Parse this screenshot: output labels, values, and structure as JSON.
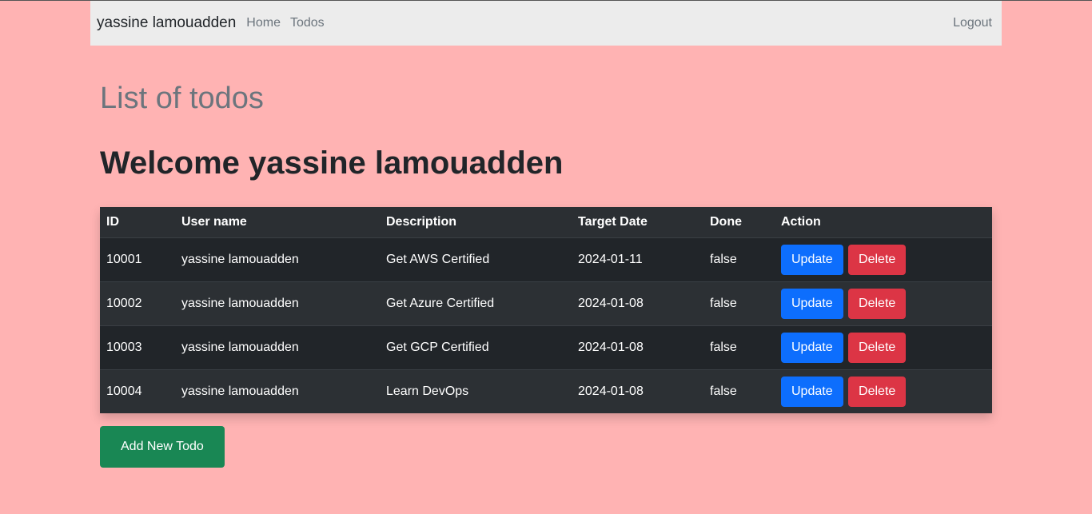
{
  "navbar": {
    "brand": "yassine lamouadden",
    "links": [
      "Home",
      "Todos"
    ],
    "logout": "Logout"
  },
  "page": {
    "title": "List of todos",
    "welcome": "Welcome yassine lamouadden"
  },
  "table": {
    "headers": [
      "ID",
      "User name",
      "Description",
      "Target Date",
      "Done",
      "Action"
    ],
    "rows": [
      {
        "id": "10001",
        "user": "yassine lamouadden",
        "description": "Get AWS Certified",
        "date": "2024-01-11",
        "done": "false"
      },
      {
        "id": "10002",
        "user": "yassine lamouadden",
        "description": "Get Azure Certified",
        "date": "2024-01-08",
        "done": "false"
      },
      {
        "id": "10003",
        "user": "yassine lamouadden",
        "description": "Get GCP Certified",
        "date": "2024-01-08",
        "done": "false"
      },
      {
        "id": "10004",
        "user": "yassine lamouadden",
        "description": "Learn DevOps",
        "date": "2024-01-08",
        "done": "false"
      }
    ],
    "update_label": "Update",
    "delete_label": "Delete"
  },
  "add_button": "Add New Todo",
  "colors": {
    "background": "#ffb3b3",
    "update": "#0d6efd",
    "delete": "#dc3545",
    "add": "#198754"
  }
}
